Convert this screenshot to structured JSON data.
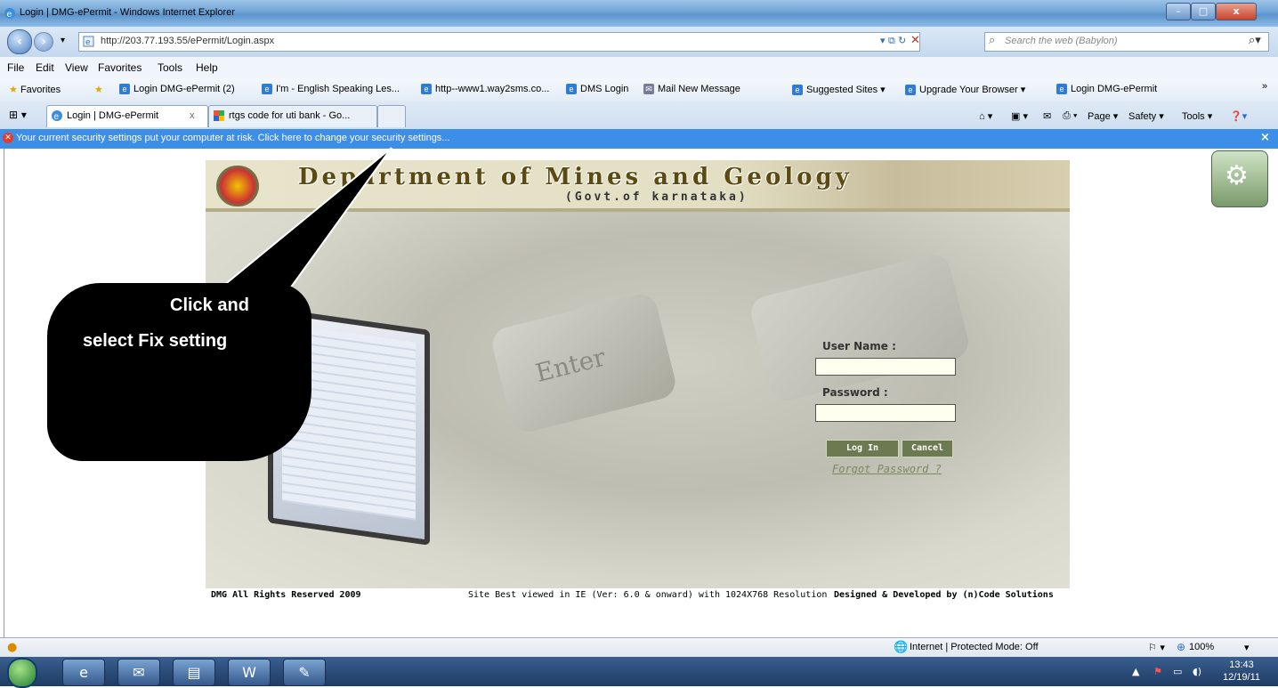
{
  "window": {
    "title": "Login | DMG-ePermit - Windows Internet Explorer",
    "controls": {
      "minimize": "–",
      "maximize": "□",
      "close": "x"
    }
  },
  "address": {
    "url": "http://203.77.193.55/ePermit/Login.aspx",
    "search_placeholder": "Search the web (Babylon)"
  },
  "menu": [
    "File",
    "Edit",
    "View",
    "Favorites",
    "Tools",
    "Help"
  ],
  "favorites": {
    "label": "Favorites",
    "items": [
      "Login DMG-ePermit (2)",
      "I'm - English Speaking Les...",
      "http--www1.way2sms.co...",
      "DMS Login",
      "Mail New Message",
      "Suggested Sites ▾",
      "Upgrade Your Browser ▾",
      "Login DMG-ePermit"
    ]
  },
  "tabs": [
    {
      "label": "Login | DMG-ePermit",
      "close": "x"
    },
    {
      "label": "rtgs code for uti bank - Go..."
    }
  ],
  "commandbar": {
    "page": "Page ▾",
    "safety": "Safety ▾",
    "tools": "Tools ▾"
  },
  "infobar": {
    "message": "Your current security settings put your computer at risk. Click here to change your security settings...",
    "close": "×"
  },
  "site": {
    "title": "Department of Mines and Geology",
    "subtitle": "(Govt.of karnataka)",
    "enter_key": "Enter",
    "username_label": "User Name :",
    "password_label": "Password :",
    "username_value": "",
    "password_value": "",
    "login_button": "Log In",
    "cancel_button": "Cancel",
    "forgot_link": "Forgot Password ?",
    "footer": {
      "rights": "DMG All Rights Reserved 2009",
      "best_viewed": "Site Best viewed in IE (Ver: 6.0 & onward) with 1024X768 Resolution",
      "designed_by": "Designed & Developed by (n)Code Solutions"
    }
  },
  "callout": {
    "line1": "Click and",
    "line2": "select Fix setting"
  },
  "statusbar": {
    "zone": "Internet | Protected Mode: Off",
    "zoom": "100%"
  },
  "taskbar": {
    "time": "13:43",
    "date": "12/19/11"
  }
}
